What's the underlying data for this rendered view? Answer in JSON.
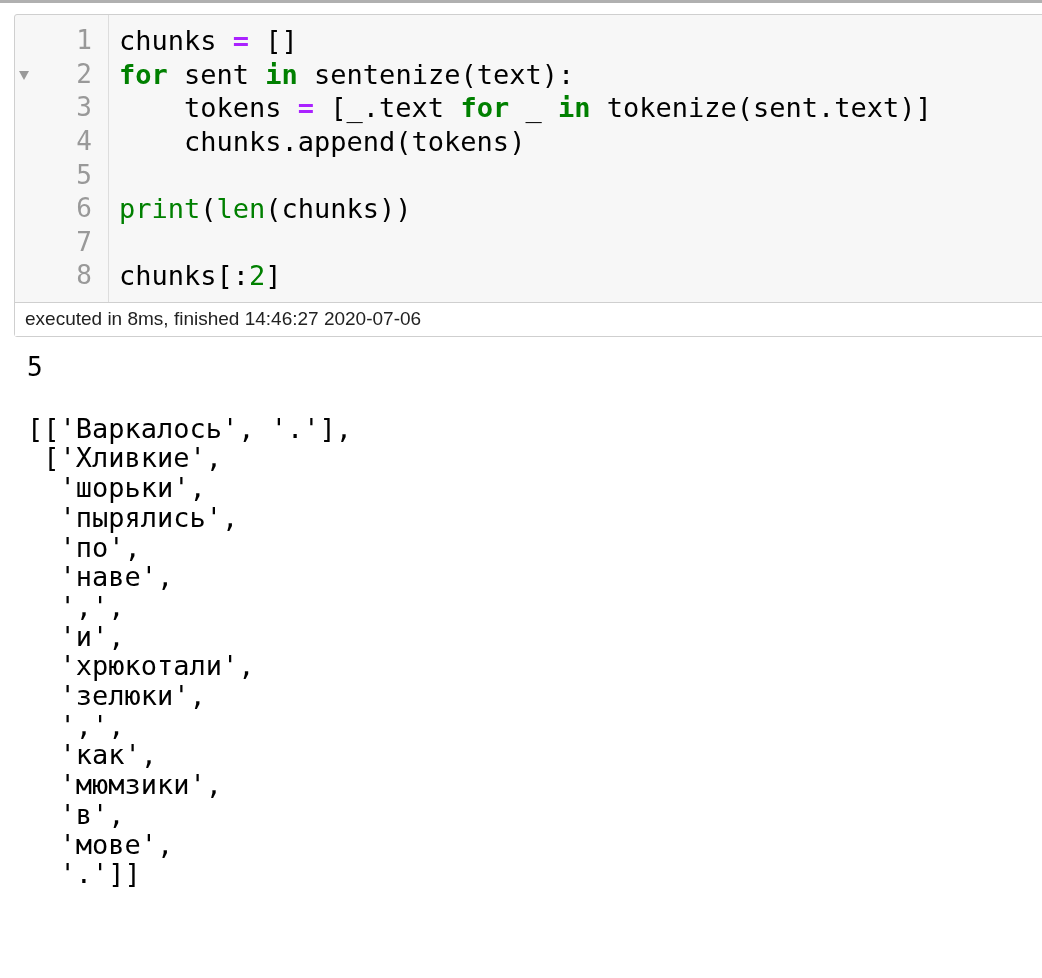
{
  "code_cell": {
    "lines": [
      {
        "number": "1",
        "foldable": false,
        "tokens": [
          {
            "text": "chunks ",
            "kind": "plain"
          },
          {
            "text": "=",
            "kind": "operator"
          },
          {
            "text": " []",
            "kind": "plain"
          }
        ]
      },
      {
        "number": "2",
        "foldable": true,
        "tokens": [
          {
            "text": "for",
            "kind": "keyword"
          },
          {
            "text": " sent ",
            "kind": "plain"
          },
          {
            "text": "in",
            "kind": "keyword"
          },
          {
            "text": " sentenize(text):",
            "kind": "plain"
          }
        ]
      },
      {
        "number": "3",
        "foldable": false,
        "tokens": [
          {
            "text": "    tokens ",
            "kind": "plain"
          },
          {
            "text": "=",
            "kind": "operator"
          },
          {
            "text": " [_.text ",
            "kind": "plain"
          },
          {
            "text": "for",
            "kind": "keyword"
          },
          {
            "text": " _ ",
            "kind": "plain"
          },
          {
            "text": "in",
            "kind": "keyword"
          },
          {
            "text": " tokenize(sent.text)]",
            "kind": "plain"
          }
        ]
      },
      {
        "number": "4",
        "foldable": false,
        "tokens": [
          {
            "text": "    chunks.append(tokens)",
            "kind": "plain"
          }
        ]
      },
      {
        "number": "5",
        "foldable": false
      },
      {
        "number": "6",
        "foldable": false,
        "tokens": [
          {
            "text": "print",
            "kind": "builtin"
          },
          {
            "text": "(",
            "kind": "plain"
          },
          {
            "text": "len",
            "kind": "builtin"
          },
          {
            "text": "(chunks))",
            "kind": "plain"
          }
        ]
      },
      {
        "number": "7",
        "foldable": false
      },
      {
        "number": "8",
        "foldable": false,
        "tokens": [
          {
            "text": "chunks[:",
            "kind": "plain"
          },
          {
            "text": "2",
            "kind": "number"
          },
          {
            "text": "]",
            "kind": "plain"
          }
        ]
      }
    ],
    "execution_info": "executed in 8ms, finished 14:46:27 2020-07-06"
  },
  "output": {
    "print_output": "5",
    "result_lines": [
      "[['Варкалось', '.'],",
      " ['Хливкие',",
      "  'шорьки',",
      "  'пырялись',",
      "  'по',",
      "  'наве',",
      "  ',',",
      "  'и',",
      "  'хрюкотали',",
      "  'зелюки',",
      "  ',',",
      "  'как',",
      "  'мюмзики',",
      "  'в',",
      "  'мове',",
      "  '.']]"
    ]
  }
}
